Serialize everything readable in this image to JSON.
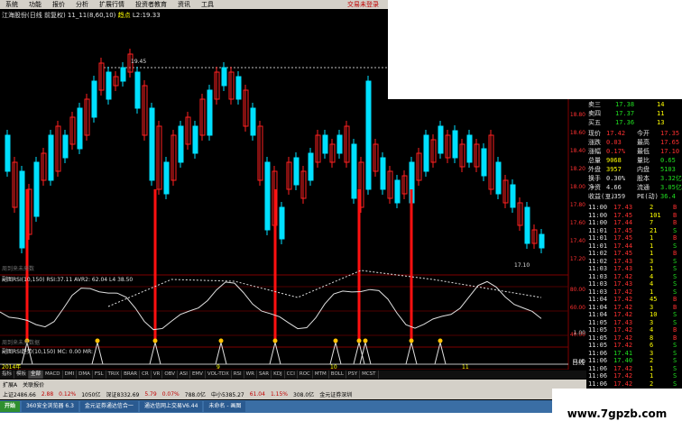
{
  "menu": {
    "items": [
      "系统",
      "功能",
      "报价",
      "分析",
      "扩展行情",
      "投资者教育",
      "资讯",
      "工具"
    ],
    "login": "交易未登录"
  },
  "title": {
    "stock": "江海股份(日线 前复权) 11_11(8,60,10)",
    "indicator": "趋点",
    "l2": "L2:19.33"
  },
  "chart": {
    "high_label": "19.45",
    "low_label": "17.10",
    "price_axis": [
      "18.80",
      "18.60",
      "18.40",
      "18.20",
      "18.00",
      "17.80",
      "17.60",
      "17.40",
      "17.20"
    ],
    "panel1_title": "副图RSI(10,150) RSI:37.11 AVR2:",
    "panel1_values": [
      "62.04",
      "L4",
      "38.50"
    ],
    "panel1_axis": [
      "80.00",
      "60.00",
      "40.00"
    ],
    "panel1_note": "周到来未来数",
    "panel2_title": "副图RSI趋势(10,150) MC: 0.00 MR:",
    "panel2_axis": [
      "1.00",
      "0.00"
    ],
    "panel2_note": "周到来未来数据",
    "date_labels": [
      "2014年",
      "9",
      "10",
      "11"
    ]
  },
  "quote": {
    "asks": [
      {
        "label": "卖三",
        "price": "17.38",
        "vol": "14"
      },
      {
        "label": "卖四",
        "price": "17.37",
        "vol": "11"
      },
      {
        "label": "买五",
        "price": "17.36",
        "vol": "13"
      }
    ],
    "stats": [
      {
        "l": "现价",
        "v": "17.42",
        "l2": "今开",
        "v2": "17.35"
      },
      {
        "l": "涨跌",
        "v": "0.03",
        "l2": "最高",
        "v2": "17.65"
      },
      {
        "l": "涨幅",
        "v": "0.17%",
        "l2": "最低",
        "v2": "17.10"
      },
      {
        "l": "总量",
        "v": "9068",
        "l2": "量比",
        "v2": "0.65"
      },
      {
        "l": "外盘",
        "v": "3957",
        "l2": "内盘",
        "v2": "5103"
      },
      {
        "l": "换手",
        "v": "0.30%",
        "l2": "股本",
        "v2": "3.32亿"
      },
      {
        "l": "净资",
        "v": "4.66",
        "l2": "流通",
        "v2": "3.05亿"
      },
      {
        "l": "收益(三)",
        "v": "0.359",
        "l2": "PE(动)",
        "v2": "36.4"
      }
    ],
    "ticks": [
      {
        "t": "11:00",
        "p": "17.43",
        "v": "2",
        "f": "B"
      },
      {
        "t": "11:00",
        "p": "17.45",
        "v": "101",
        "f": "B"
      },
      {
        "t": "11:00",
        "p": "17.44",
        "v": "7",
        "f": "B"
      },
      {
        "t": "11:01",
        "p": "17.45",
        "v": "21",
        "f": "S"
      },
      {
        "t": "11:01",
        "p": "17.45",
        "v": "1",
        "f": "B"
      },
      {
        "t": "11:01",
        "p": "17.44",
        "v": "1",
        "f": "S"
      },
      {
        "t": "11:02",
        "p": "17.45",
        "v": "1",
        "f": "B"
      },
      {
        "t": "11:02",
        "p": "17.43",
        "v": "3",
        "f": "S"
      },
      {
        "t": "11:03",
        "p": "17.43",
        "v": "1",
        "f": "S"
      },
      {
        "t": "11:03",
        "p": "17.42",
        "v": "4",
        "f": "S"
      },
      {
        "t": "11:03",
        "p": "17.43",
        "v": "4",
        "f": "S"
      },
      {
        "t": "11:03",
        "p": "17.42",
        "v": "1",
        "f": "S"
      },
      {
        "t": "11:04",
        "p": "17.42",
        "v": "45",
        "f": "B"
      },
      {
        "t": "11:04",
        "p": "17.42",
        "v": "3",
        "f": "B"
      },
      {
        "t": "11:04",
        "p": "17.42",
        "v": "10",
        "f": "S"
      },
      {
        "t": "11:05",
        "p": "17.43",
        "v": "3",
        "f": "S"
      },
      {
        "t": "11:05",
        "p": "17.42",
        "v": "4",
        "f": "B"
      },
      {
        "t": "11:05",
        "p": "17.42",
        "v": "8",
        "f": "B"
      },
      {
        "t": "11:05",
        "p": "17.42",
        "v": "6",
        "f": "S"
      },
      {
        "t": "11:06",
        "p": "17.41",
        "v": "3",
        "f": "S"
      },
      {
        "t": "11:06",
        "p": "17.40",
        "v": "2",
        "f": "S"
      },
      {
        "t": "11:06",
        "p": "17.42",
        "v": "1",
        "f": "S"
      },
      {
        "t": "11:06",
        "p": "17.42",
        "v": "1",
        "f": "S"
      },
      {
        "t": "11:06",
        "p": "17.42",
        "v": "2",
        "f": "S"
      }
    ],
    "footer": "日线"
  },
  "tabs": [
    "指标",
    "模板",
    "全部",
    "MACD",
    "DMI",
    "DMA",
    "FSL",
    "TRIX",
    "BRAR",
    "CR",
    "VR",
    "OBV",
    "ASI",
    "EMV",
    "VOL-TDX",
    "RSI",
    "WR",
    "SAR",
    "KDJ",
    "CCI",
    "ROC",
    "MTM",
    "BOLL",
    "PSY",
    "MCST"
  ],
  "subtabs": [
    "扩展A",
    "关联报价"
  ],
  "status": [
    "上证2486.66",
    "2.88",
    "0.12%",
    "1050亿",
    "深证8332.69",
    "5.79",
    "0.07%",
    "788.0亿",
    "中小5385.27",
    "61.04",
    "1.15%",
    "308.0亿",
    "金元证券深圳"
  ],
  "taskbar": [
    "开始",
    "360安全浏览器 6.3",
    "金元证券通达信合一",
    "通达信网上交易V6.44",
    "未命名 - 画图"
  ],
  "watermark": "www.7gpzb.com"
}
